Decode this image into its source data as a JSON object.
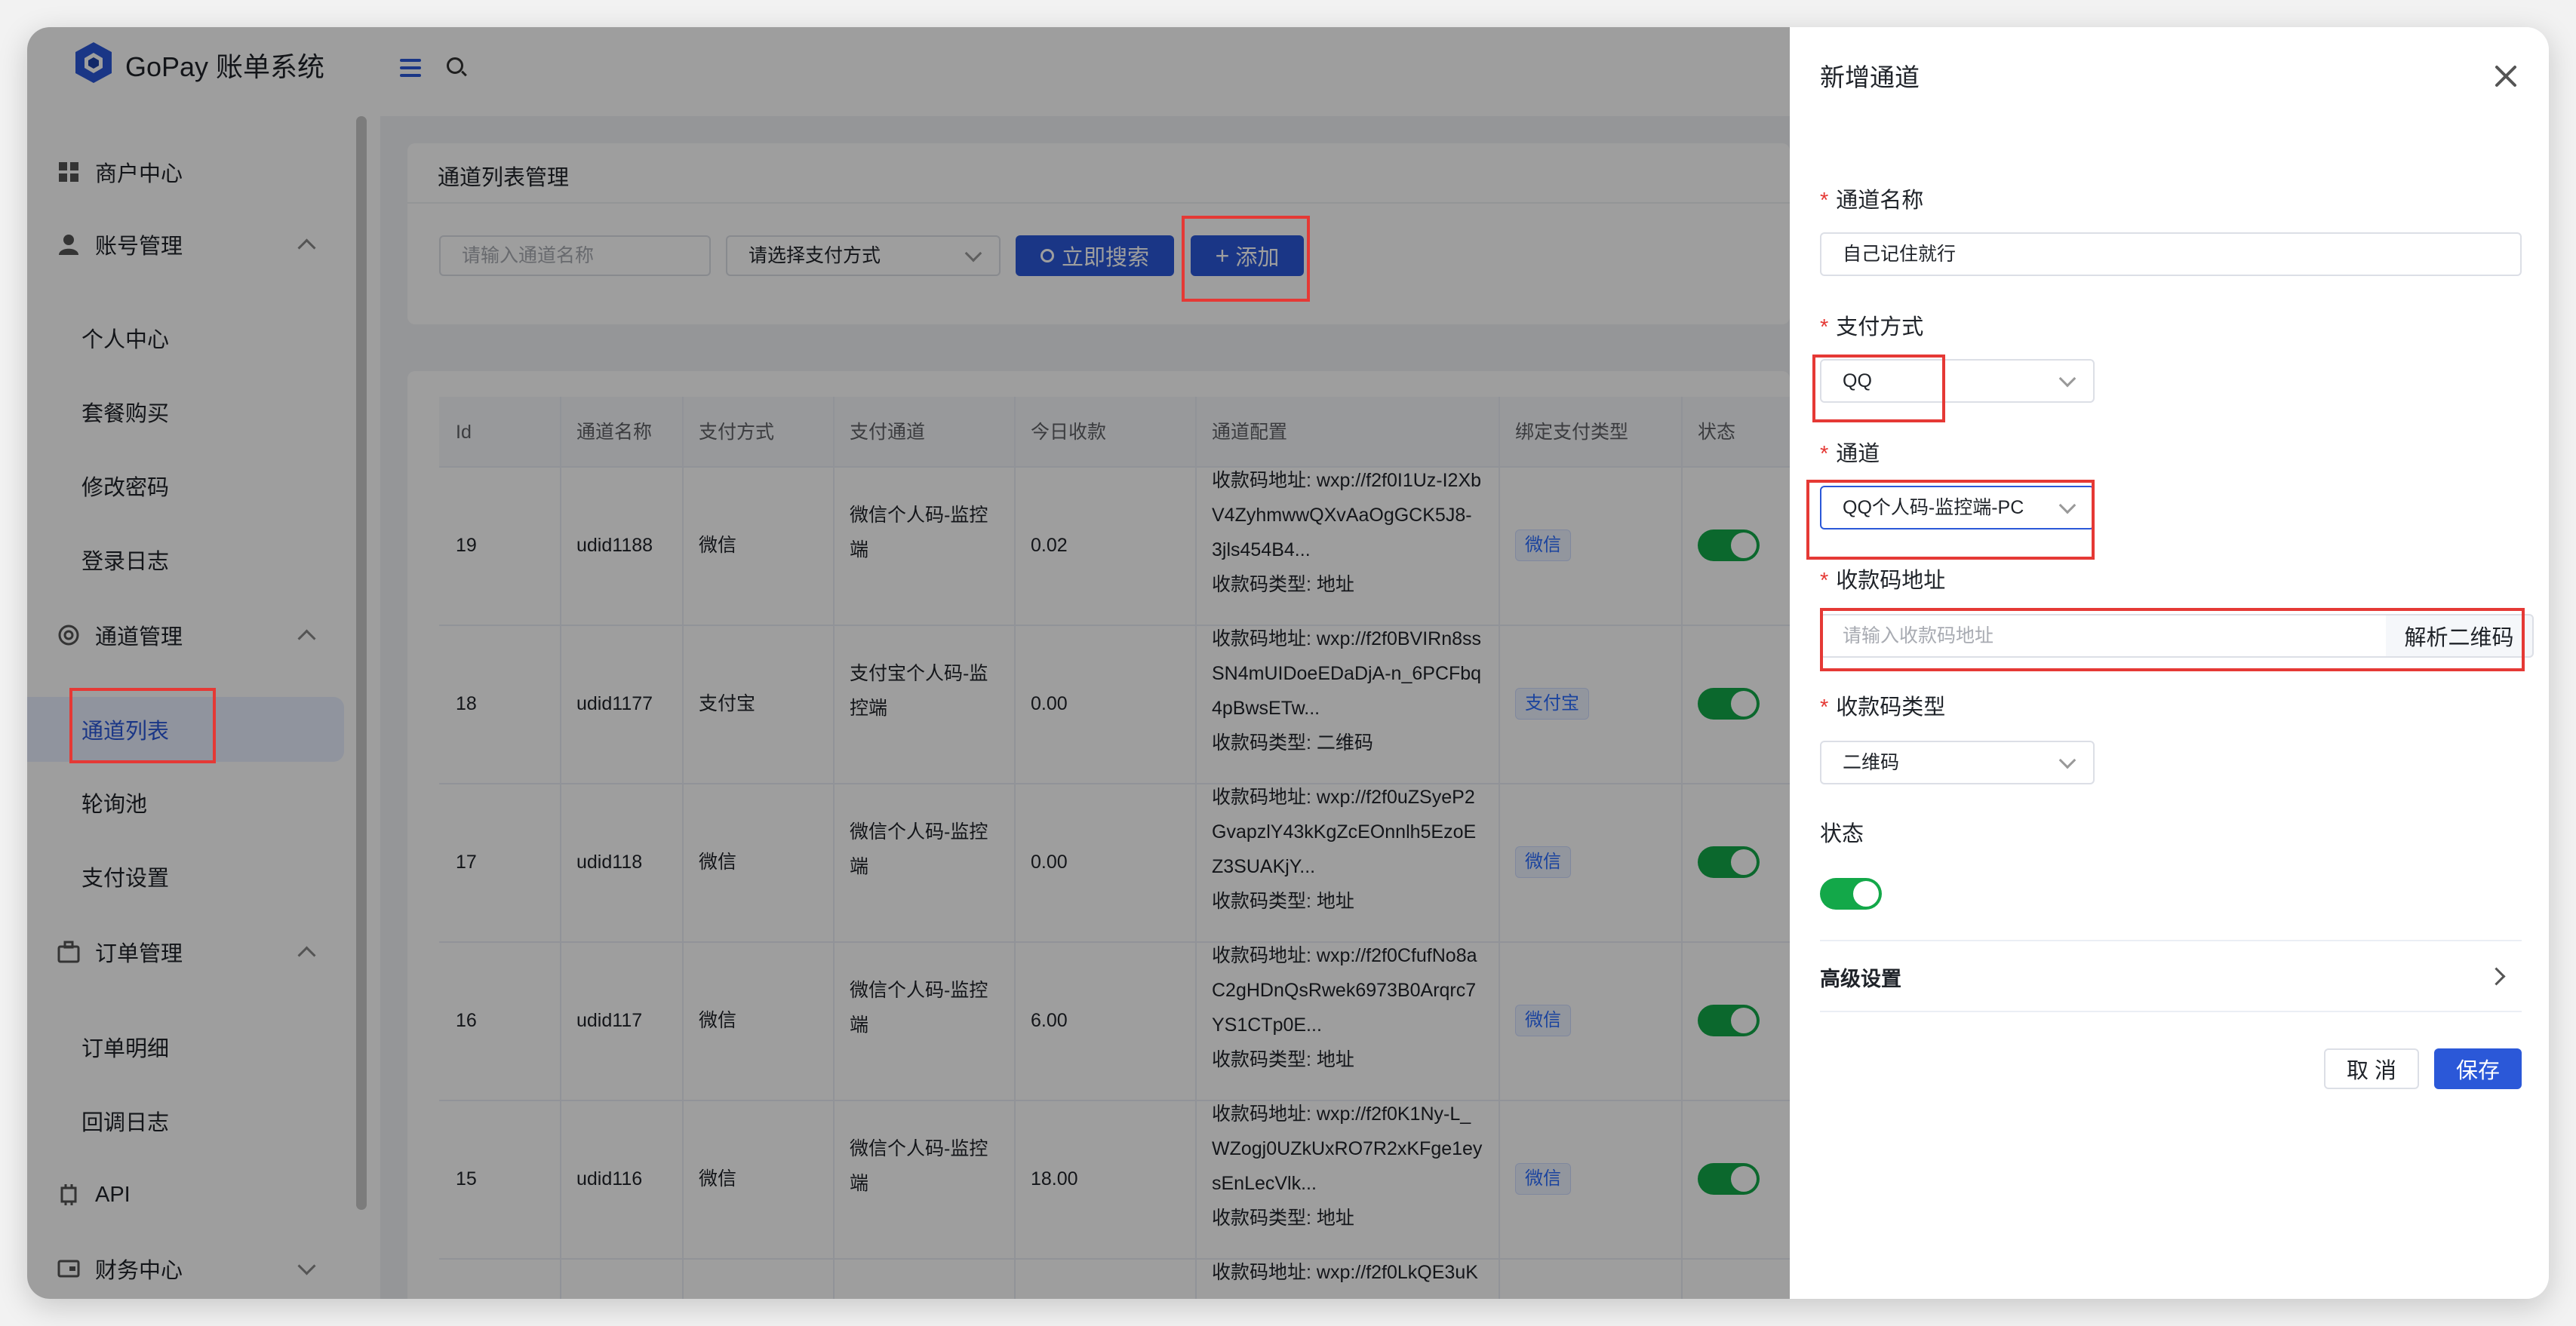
{
  "app": {
    "brand": "GoPay 账单系统"
  },
  "sidebar": {
    "groups": [
      {
        "label": "商户中心"
      },
      {
        "label": "账号管理",
        "children": [
          "个人中心",
          "套餐购买",
          "修改密码",
          "登录日志"
        ]
      },
      {
        "label": "通道管理",
        "children": [
          "通道列表",
          "轮询池",
          "支付设置"
        ]
      },
      {
        "label": "订单管理",
        "children": [
          "订单明细",
          "回调日志"
        ]
      },
      {
        "label": "API"
      },
      {
        "label": "财务中心"
      }
    ],
    "active": "通道列表"
  },
  "search_card": {
    "title": "通道列表管理",
    "name_placeholder": "请输入通道名称",
    "pay_method_placeholder": "请选择支付方式",
    "search_button": "立即搜索",
    "add_button": "添加"
  },
  "table": {
    "columns": [
      "Id",
      "通道名称",
      "支付方式",
      "支付通道",
      "今日收款",
      "通道配置",
      "绑定支付类型",
      "状态"
    ],
    "rows": [
      {
        "id": "19",
        "name": "udid1188",
        "method": "微信",
        "channel": [
          "微信个人码-监控",
          "端"
        ],
        "today": "0.02",
        "config": [
          "收款码地址: wxp://f2f0I1Uz-I2Xb",
          "V4ZyhmwwQXvAaOgGCK5J8-",
          "3jls454B4...",
          "收款码类型: 地址"
        ],
        "tag": "微信"
      },
      {
        "id": "18",
        "name": "udid1177",
        "method": "支付宝",
        "channel": [
          "支付宝个人码-监",
          "控端"
        ],
        "today": "0.00",
        "config": [
          "收款码地址: wxp://f2f0BVIRn8ss",
          "SN4mUIDoeEDaDjA-n_6PCFbq",
          "4pBwsETw...",
          "收款码类型: 二维码"
        ],
        "tag": "支付宝"
      },
      {
        "id": "17",
        "name": "udid118",
        "method": "微信",
        "channel": [
          "微信个人码-监控",
          "端"
        ],
        "today": "0.00",
        "config": [
          "收款码地址: wxp://f2f0uZSyeP2",
          "GvapzlY43kKgZcEOnnlh5EzoE",
          "Z3SUAKjY...",
          "收款码类型: 地址"
        ],
        "tag": "微信"
      },
      {
        "id": "16",
        "name": "udid117",
        "method": "微信",
        "channel": [
          "微信个人码-监控",
          "端"
        ],
        "today": "6.00",
        "config": [
          "收款码地址: wxp://f2f0CfufNo8a",
          "C2gHDnQsRwek6973B0Arqrc7",
          "YS1CTp0E...",
          "收款码类型: 地址"
        ],
        "tag": "微信"
      },
      {
        "id": "15",
        "name": "udid116",
        "method": "微信",
        "channel": [
          "微信个人码-监控",
          "端"
        ],
        "today": "18.00",
        "config": [
          "收款码地址: wxp://f2f0K1Ny-L_",
          "WZogj0UZkUxRO7R2xKFge1ey",
          "sEnLecVlk...",
          "收款码类型: 地址"
        ],
        "tag": "微信"
      },
      {
        "config": [
          "收款码地址: wxp://f2f0LkQE3uK"
        ]
      }
    ]
  },
  "drawer": {
    "title": "新增通道",
    "fields": {
      "name": {
        "label": "通道名称",
        "value": "自己记住就行"
      },
      "pay_method": {
        "label": "支付方式",
        "value": "QQ"
      },
      "channel": {
        "label": "通道",
        "value": "QQ个人码-监控端-PC"
      },
      "qr_address": {
        "label": "收款码地址",
        "placeholder": "请输入收款码地址",
        "button": "解析二维码"
      },
      "qr_type": {
        "label": "收款码类型",
        "value": "二维码"
      },
      "status": {
        "label": "状态"
      }
    },
    "advanced": "高级设置",
    "cancel": "取 消",
    "save": "保存"
  },
  "colors": {
    "primary": "#2b58d8",
    "switch_on": "#13a849",
    "highlight": "#e53935"
  }
}
